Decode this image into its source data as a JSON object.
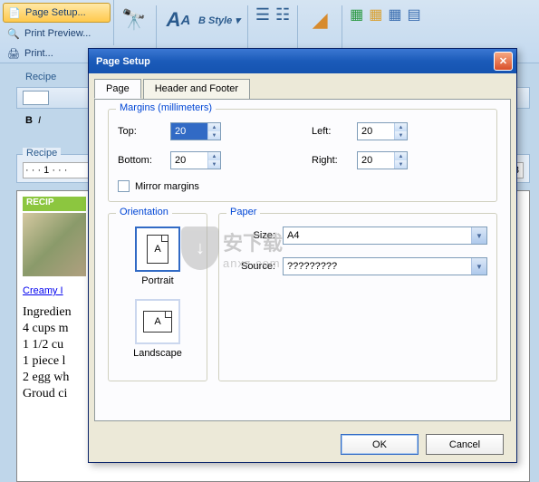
{
  "ribbon": {
    "page_setup": "Page Setup...",
    "print_preview": "Print Preview...",
    "print": "Print...",
    "style_label": "Style"
  },
  "doc": {
    "tab1": "Recipe",
    "ruler_title": "Recipe",
    "ruler_marks": "· · · 1 · · ·",
    "ruler_right": "13",
    "recipe_banner": "RECIP",
    "link": "Creamy I",
    "lines": [
      "Ingredien",
      "4 cups m",
      "1 1/2 cu",
      "1 piece l",
      "2 egg wh",
      "Groud ci"
    ]
  },
  "dialog": {
    "title": "Page Setup",
    "tabs": {
      "page": "Page",
      "header_footer": "Header and Footer"
    },
    "margins": {
      "legend": "Margins (millimeters)",
      "top_label": "Top:",
      "top_value": "20",
      "left_label": "Left:",
      "left_value": "20",
      "bottom_label": "Bottom:",
      "bottom_value": "20",
      "right_label": "Right:",
      "right_value": "20",
      "mirror": "Mirror margins"
    },
    "orientation": {
      "legend": "Orientation",
      "portrait": "Portrait",
      "landscape": "Landscape",
      "glyph": "A"
    },
    "paper": {
      "legend": "Paper",
      "size_label": "Size:",
      "size_value": "A4",
      "source_label": "Source:",
      "source_value": "?????????"
    },
    "ok": "OK",
    "cancel": "Cancel"
  },
  "watermark": {
    "cn": "安下载",
    "en": "anxz.com"
  }
}
